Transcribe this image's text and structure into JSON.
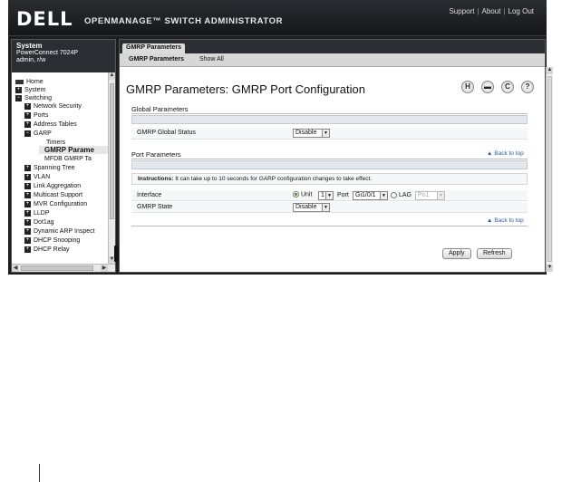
{
  "header": {
    "logo": "DELL",
    "product": "OPENMANAGE™ SWITCH ADMINISTRATOR",
    "links": [
      "Support",
      "About",
      "Log Out"
    ]
  },
  "sidebar": {
    "system_title": "System",
    "device": "PowerConnect 7024P",
    "user": "admin, r/w",
    "tree": [
      {
        "label": "Home",
        "icon": "home-icon"
      },
      {
        "label": "System",
        "icon": "plus"
      },
      {
        "label": "Switching",
        "icon": "minus"
      },
      {
        "label": "Network Security",
        "icon": "plus"
      },
      {
        "label": "Ports",
        "icon": "plus"
      },
      {
        "label": "Address Tables",
        "icon": "plus"
      },
      {
        "label": "GARP",
        "icon": "minus"
      },
      {
        "label": "Timers",
        "icon": ""
      },
      {
        "label": "GMRP Parame",
        "icon": ""
      },
      {
        "label": "MFDB GMRP Ta",
        "icon": ""
      },
      {
        "label": "Spanning Tree",
        "icon": "plus"
      },
      {
        "label": "VLAN",
        "icon": "plus"
      },
      {
        "label": "Link Aggregation",
        "icon": "plus"
      },
      {
        "label": "Multicast Support",
        "icon": "plus"
      },
      {
        "label": "MVR Configuration",
        "icon": "plus"
      },
      {
        "label": "LLDP",
        "icon": "plus"
      },
      {
        "label": "Dot1ag",
        "icon": "plus"
      },
      {
        "label": "Dynamic ARP Inspect",
        "icon": "plus"
      },
      {
        "label": "DHCP Snooping",
        "icon": "plus"
      },
      {
        "label": "DHCP Relay",
        "icon": "plus"
      }
    ]
  },
  "main": {
    "tab": "GMRP Parameters",
    "subtabs": [
      "GMRP Parameters",
      "Show All"
    ],
    "title": "GMRP Parameters: GMRP Port Configuration",
    "toolbar_icons": [
      "H",
      "print",
      "C",
      "?"
    ],
    "global_section": "Global Parameters",
    "global_status_label": "GMRP Global Status",
    "global_status_value": "Disable",
    "port_section": "Port Parameters",
    "back_to_top": "Back to top",
    "instructions_label": "Instructions:",
    "instructions_text": "It can take up to 10 seconds for GARP configuration changes to take effect.",
    "interface_label": "Interface",
    "unit_label": "Unit",
    "unit_value": "1",
    "port_label": "Port",
    "port_value": "Gi1/0/1",
    "lag_label": "LAG",
    "lag_value": "Po1",
    "state_label": "GMRP State",
    "state_value": "Disable",
    "apply": "Apply",
    "refresh": "Refresh"
  }
}
